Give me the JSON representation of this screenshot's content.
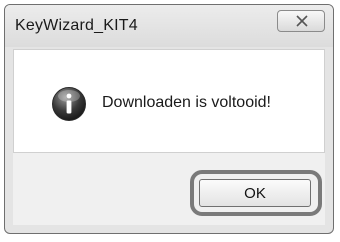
{
  "window": {
    "title": "KeyWizard_KIT4"
  },
  "dialog": {
    "message": "Downloaden is voltooid!",
    "icon": "info-icon"
  },
  "buttons": {
    "ok_label": "OK",
    "close_icon": "close-icon"
  }
}
